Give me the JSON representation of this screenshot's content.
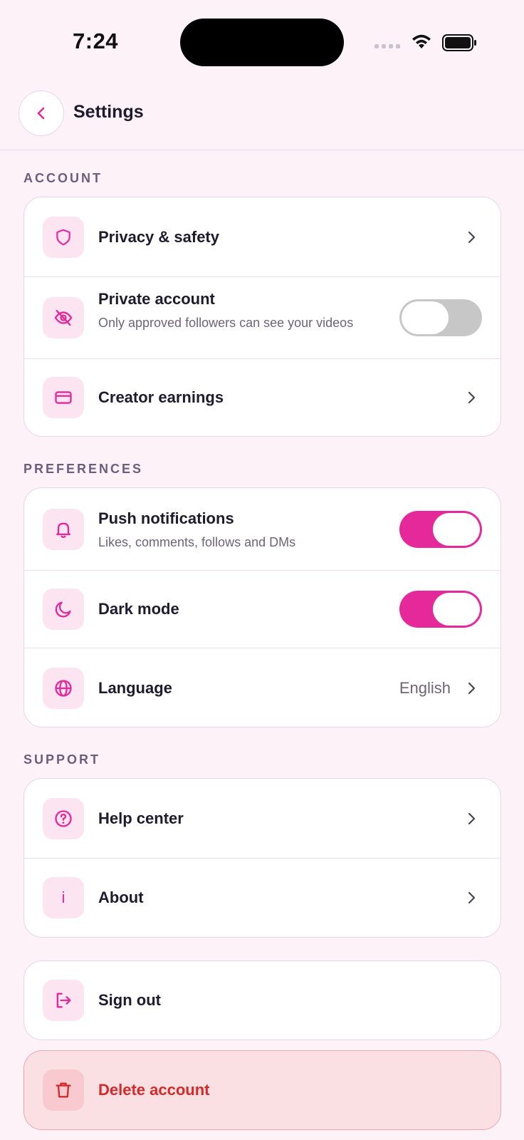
{
  "status_bar": {
    "time": "7:24"
  },
  "header": {
    "title": "Settings"
  },
  "sections": {
    "account": {
      "label": "ACCOUNT",
      "privacy": {
        "title": "Privacy & safety"
      },
      "private_account": {
        "title": "Private account",
        "subtitle": "Only approved followers can see your videos",
        "enabled": false
      },
      "creator_earnings": {
        "title": "Creator earnings"
      }
    },
    "preferences": {
      "label": "PREFERENCES",
      "push_notifications": {
        "title": "Push notifications",
        "subtitle": "Likes, comments, follows and DMs",
        "enabled": true
      },
      "dark_mode": {
        "title": "Dark mode",
        "enabled": true
      },
      "language": {
        "title": "Language",
        "value": "English"
      }
    },
    "support": {
      "label": "SUPPORT",
      "help_center": {
        "title": "Help center"
      },
      "about": {
        "title": "About",
        "icon_glyph": "i"
      }
    }
  },
  "actions": {
    "sign_out": {
      "title": "Sign out"
    },
    "delete_account": {
      "title": "Delete account"
    }
  },
  "icons": [
    "back-chevron-icon",
    "shield-icon",
    "eye-off-icon",
    "credit-card-icon",
    "bell-icon",
    "moon-icon",
    "globe-icon",
    "help-circle-icon",
    "info-icon",
    "sign-out-icon",
    "trash-icon",
    "chevron-right-icon"
  ],
  "colors": {
    "accent": "#e5289a",
    "background": "#fdf2f8",
    "danger": "#d42a2a",
    "toggle_off": "#c7c7c7"
  }
}
